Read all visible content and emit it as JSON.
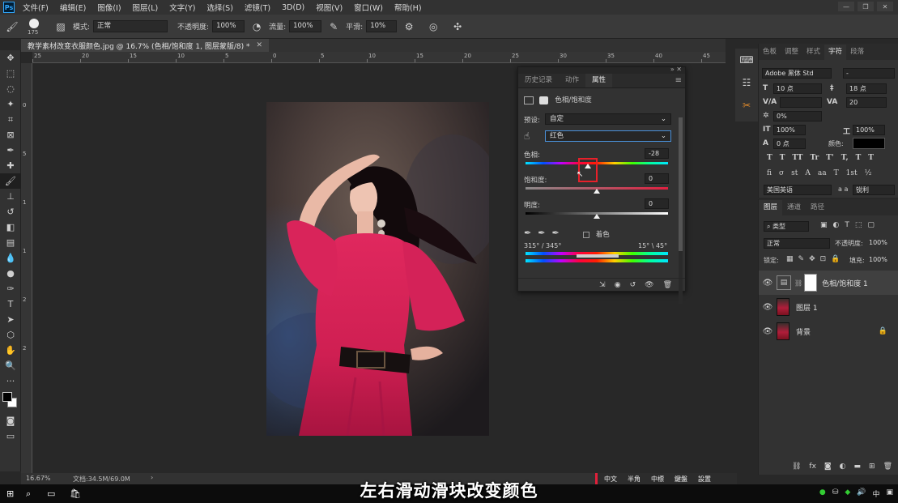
{
  "menubar": {
    "items": [
      "文件(F)",
      "编辑(E)",
      "图像(I)",
      "图层(L)",
      "文字(Y)",
      "选择(S)",
      "滤镜(T)",
      "3D(D)",
      "视图(V)",
      "窗口(W)",
      "帮助(H)"
    ]
  },
  "options": {
    "brush_size": "175",
    "mode_label": "模式:",
    "mode_value": "正常",
    "opacity_label": "不透明度:",
    "opacity_value": "100%",
    "flow_label": "流量:",
    "flow_value": "100%",
    "smooth_label": "平滑:",
    "smooth_value": "10%"
  },
  "document": {
    "tab_title": "教学素材改变衣服颜色.jpg @ 16.7% (色相/饱和度 1, 图层蒙版/8) *",
    "ruler_top": [
      "25",
      "20",
      "15",
      "10",
      "5",
      "0",
      "5",
      "10",
      "15",
      "20",
      "25",
      "30",
      "35",
      "40",
      "45"
    ],
    "ruler_left": [
      "0",
      "5",
      "1",
      "1",
      "2",
      "2"
    ]
  },
  "properties": {
    "tabs": [
      "历史记录",
      "动作",
      "属性"
    ],
    "active_tab": 2,
    "title": "色相/饱和度",
    "preset_label": "预设:",
    "preset_value": "自定",
    "channel_value": "红色",
    "hue_label": "色相:",
    "hue_value": "-28",
    "hue_fraction": 0.44,
    "saturation_label": "饱和度:",
    "saturation_value": "0",
    "saturation_fraction": 0.5,
    "lightness_label": "明度:",
    "lightness_value": "0",
    "lightness_fraction": 0.5,
    "colorize_label": "着色",
    "range_left": "315° / 345°",
    "range_right": "15° \\ 45°",
    "highlight_color": "#e8202a"
  },
  "character": {
    "tabs": [
      "色板",
      "调整",
      "样式",
      "字符",
      "段落"
    ],
    "active_tab": 3,
    "font_family": "Adobe 黑体 Std",
    "font_style": "-",
    "font_size": "10 点",
    "leading": "18 点",
    "kerning": "",
    "tracking": "20",
    "scale_percent": "0%",
    "vertical_scale": "100%",
    "horizontal_scale": "100%",
    "baseline_shift": "0 点",
    "color_label": "颜色:",
    "glyphs_row1": [
      "T",
      "T",
      "TT",
      "Tr",
      "T'",
      "T,",
      "T",
      "T"
    ],
    "glyphs_row2": [
      "fi",
      "σ",
      "st",
      "A",
      "aa",
      "T",
      "1st",
      "½"
    ],
    "language": "美国英语",
    "aa_label": "a a",
    "antialias": "锐利"
  },
  "layers": {
    "tabs": [
      "图层",
      "通道",
      "路径"
    ],
    "active_tab": 0,
    "filter_kind": "类型",
    "blend_mode": "正常",
    "opacity_label": "不透明度:",
    "opacity_value": "100%",
    "lock_label": "锁定:",
    "fill_label": "填充:",
    "fill_value": "100%",
    "items": [
      {
        "name": "色相/饱和度 1",
        "selected": true
      },
      {
        "name": "图层 1",
        "selected": false
      },
      {
        "name": "背景",
        "selected": false
      }
    ]
  },
  "status": {
    "zoom": "16.67%",
    "doc_info": "文档:34.5M/69.0M"
  },
  "ime": [
    "中文",
    "半角",
    "中標",
    "鍵盤",
    "設置"
  ],
  "caption": "左右滑动滑块改变颜色"
}
